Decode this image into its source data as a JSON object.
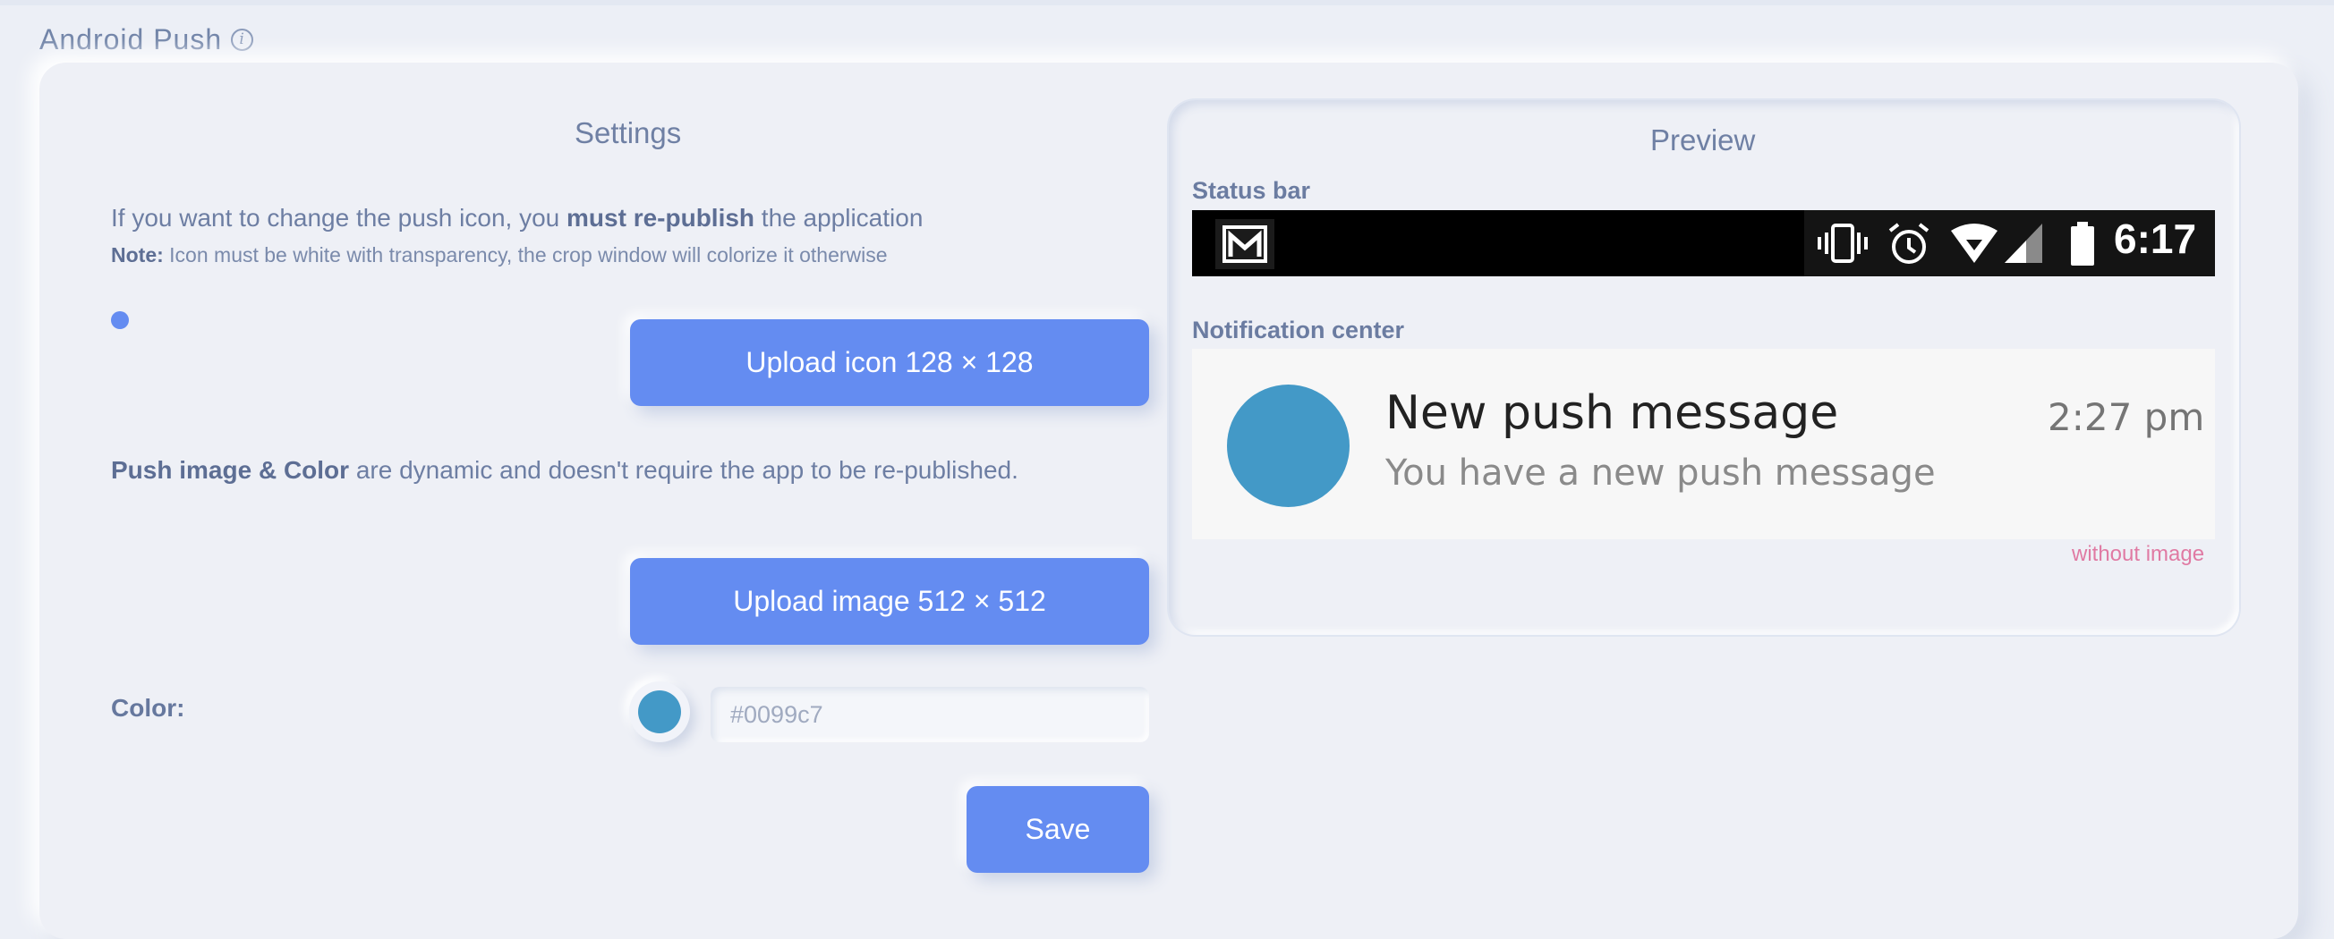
{
  "section": {
    "title": "Android Push",
    "info_icon": "info-icon"
  },
  "settings": {
    "title": "Settings",
    "line1_prefix": "If you want to change the push icon, you ",
    "line1_bold": "must re-publish",
    "line1_suffix": " the application",
    "note_label": "Note:",
    "note_text": " Icon must be white with transparency, the crop window will colorize it otherwise",
    "upload_icon_label": "Upload icon 128 × 128",
    "line3_bold": "Push image & Color",
    "line3_suffix": " are dynamic and doesn't require the app to be re-published.",
    "upload_image_label": "Upload image 512 × 512",
    "color_label": "Color:",
    "color_placeholder": "#0099c7",
    "color_value": "",
    "save_label": "Save"
  },
  "preview": {
    "title": "Preview",
    "status_bar_label": "Status bar",
    "status_time": "6:17",
    "notification_center_label": "Notification center",
    "notification": {
      "title": "New push message",
      "time": "2:27 pm",
      "body": "You have a new push message"
    },
    "without_image_label": "without image"
  },
  "colors": {
    "accent": "#648cf1",
    "push_color": "#4399c7",
    "icon_dot": "#648cf1",
    "without_image": "#e07aa3"
  }
}
